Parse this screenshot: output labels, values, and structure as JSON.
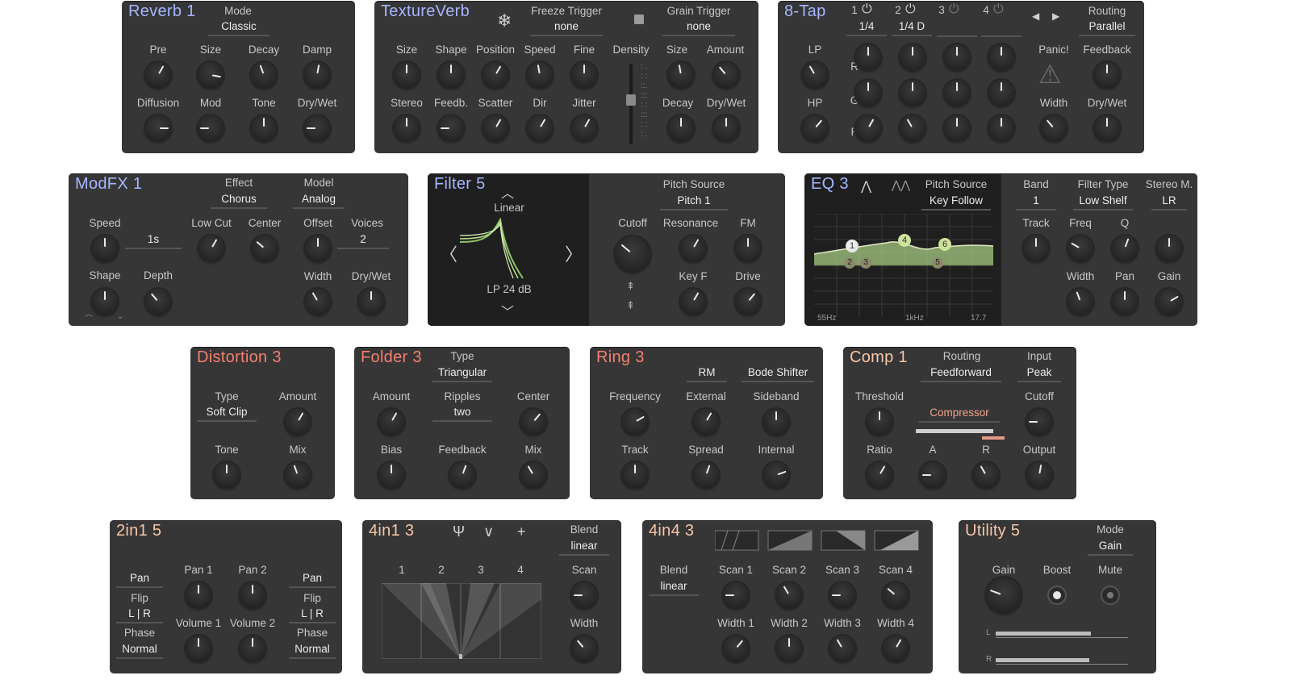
{
  "reverb": {
    "title": "Reverb 1",
    "mode_label": "Mode",
    "mode_value": "Classic",
    "labels": [
      "Pre",
      "Size",
      "Decay",
      "Damp",
      "Diffusion",
      "Mod",
      "Tone",
      "Dry/Wet"
    ]
  },
  "texture": {
    "title": "TextureVerb",
    "freeze_label": "Freeze Trigger",
    "freeze_value": "none",
    "grain_label": "Grain Trigger",
    "grain_value": "none",
    "labels": [
      "Size",
      "Shape",
      "Position",
      "Speed",
      "Fine",
      "Density",
      "Size",
      "Amount",
      "Stereo",
      "Feedb.",
      "Scatter",
      "Dir",
      "Jitter",
      "Decay",
      "Dry/Wet"
    ]
  },
  "tap": {
    "title": "8-Tap",
    "taps": [
      "1",
      "2",
      "3",
      "4"
    ],
    "tap_values": [
      "1/4",
      "1/4 D",
      "",
      ""
    ],
    "routing_label": "Routing",
    "routing_value": "Parallel",
    "labels": [
      "LP",
      "HP",
      "R",
      "G",
      "P",
      "Panic!",
      "Feedback",
      "Width",
      "Dry/Wet"
    ]
  },
  "modfx": {
    "title": "ModFX 1",
    "effect_label": "Effect",
    "effect_value": "Chorus",
    "model_label": "Model",
    "model_value": "Analog",
    "speed_value": "1s",
    "voices_value": "2",
    "labels": [
      "Speed",
      "Low Cut",
      "Center",
      "Offset",
      "Voices",
      "Shape",
      "Depth",
      "Width",
      "Dry/Wet"
    ]
  },
  "filter": {
    "title": "Filter 5",
    "curve": "Linear",
    "type": "LP 24 dB",
    "pitch_source_label": "Pitch Source",
    "pitch_source_value": "Pitch 1",
    "labels": [
      "Cutoff",
      "Resonance",
      "FM",
      "Key F",
      "Drive"
    ]
  },
  "eq": {
    "title": "EQ 3",
    "pitch_source_label": "Pitch Source",
    "pitch_source_value": "Key Follow",
    "band_label": "Band",
    "band_value": "1",
    "ftype_label": "Filter Type",
    "ftype_value": "Low Shelf",
    "stereo_label": "Stereo M.",
    "stereo_value": "LR",
    "graph_left": "55Hz",
    "graph_mid": "1kHz",
    "graph_right": "17.7",
    "nodes": [
      "1",
      "2",
      "3",
      "4",
      "5",
      "6"
    ],
    "labels": [
      "Track",
      "Freq",
      "Q",
      "Width",
      "Pan",
      "Gain"
    ]
  },
  "distortion": {
    "title": "Distortion 3",
    "type_label": "Type",
    "type_value": "Soft Clip",
    "labels": [
      "Amount",
      "Tone",
      "Mix"
    ]
  },
  "folder": {
    "title": "Folder 3",
    "type_label": "Type",
    "type_value": "Triangular",
    "ripples_label": "Ripples",
    "ripples_value": "two",
    "labels": [
      "Amount",
      "Center",
      "Bias",
      "Feedback",
      "Mix"
    ]
  },
  "ring": {
    "title": "Ring 3",
    "mode_a": "RM",
    "mode_b": "Bode Shifter",
    "labels": [
      "Frequency",
      "External",
      "Sideband",
      "Track",
      "Spread",
      "Internal"
    ]
  },
  "comp": {
    "title": "Comp 1",
    "routing_label": "Routing",
    "routing_value": "Feedforward",
    "input_label": "Input",
    "input_value": "Peak",
    "mode_value": "Compressor",
    "labels": [
      "Threshold",
      "Cutoff",
      "Ratio",
      "A",
      "R",
      "Output"
    ]
  },
  "twoin1": {
    "title": "2in1 5",
    "pan_a": "Pan",
    "pan_b": "Pan",
    "flip_label": "Flip",
    "flip_value": "L | R",
    "phase_label": "Phase",
    "phase_value": "Normal",
    "labels": [
      "Pan 1",
      "Pan 2",
      "Volume 1",
      "Volume 2"
    ]
  },
  "fourin1": {
    "title": "4in1 3",
    "blend_label": "Blend",
    "blend_value": "linear",
    "ticks": [
      "1",
      "2",
      "3",
      "4"
    ],
    "labels": [
      "Scan",
      "Width"
    ]
  },
  "fourin4": {
    "title": "4in4 3",
    "blend_label": "Blend",
    "blend_value": "linear",
    "labels": [
      "Scan 1",
      "Scan 2",
      "Scan 3",
      "Scan 4",
      "Width 1",
      "Width 2",
      "Width 3",
      "Width 4"
    ]
  },
  "utility": {
    "title": "Utility 5",
    "mode_label": "Mode",
    "mode_value": "Gain",
    "labels": [
      "Gain",
      "Boost",
      "Mute"
    ],
    "meter_l": "L",
    "meter_r": "R"
  }
}
